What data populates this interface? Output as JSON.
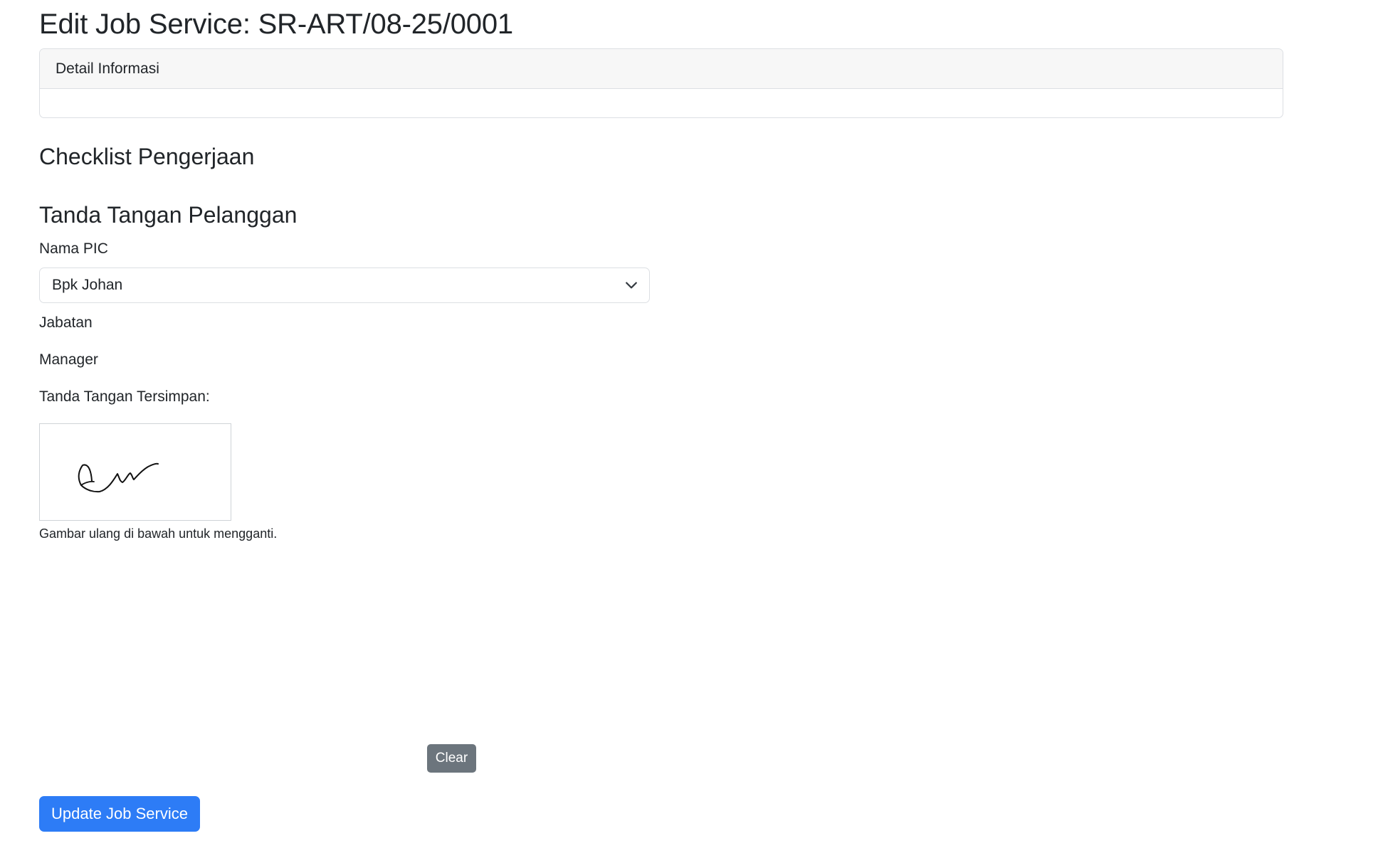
{
  "header": {
    "title": "Edit Job Service: SR-ART/08-25/0001"
  },
  "detail_card": {
    "header": "Detail Informasi"
  },
  "checklist": {
    "title": "Checklist Pengerjaan"
  },
  "signature_section": {
    "title": "Tanda Tangan Pelanggan",
    "pic_label": "Nama PIC",
    "pic_selected": "Bpk Johan",
    "position_label": "Jabatan",
    "position_value": "Manager",
    "saved_signature_label": "Tanda Tangan Tersimpan:",
    "redraw_hint": "Gambar ulang di bawah untuk mengganti.",
    "clear_label": "Clear"
  },
  "actions": {
    "submit_label": "Update Job Service",
    "submit_color": "#2d7cf6",
    "clear_color": "#6c757d"
  },
  "icons": {
    "select_toggle": "chevron-down-icon"
  }
}
